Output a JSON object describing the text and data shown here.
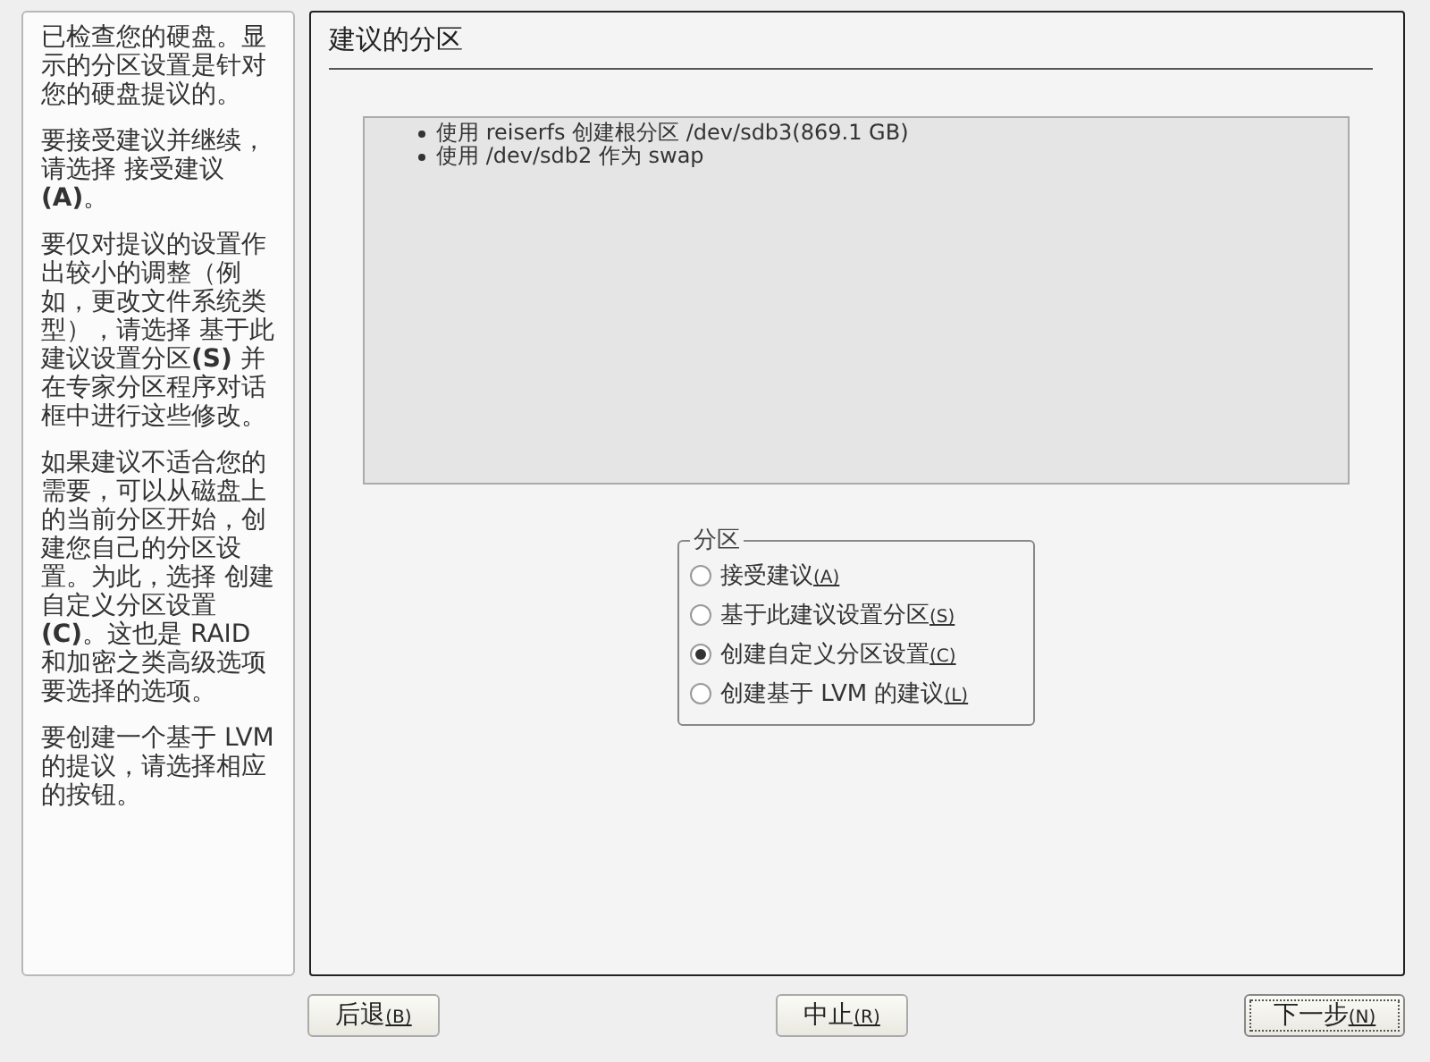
{
  "help": {
    "paragraphs": [
      "已检查您的硬盘。显示的分区设置是针对您的硬盘提议的。",
      "要接受建议并继续，请选择 接受建议**(A)**。",
      "要仅对提议的设置作出较小的调整（例如，更改文件系统类型），请选择 基于此建议设置分区**(S)** 并在专家分区程序对话框中进行这些修改。",
      "如果建议不适合您的需要，可以从磁盘上的当前分区开始，创建您自己的分区设置。为此，选择 创建自定义分区设置**(C)**。这也是 RAID 和加密之类高级选项要选择的选项。",
      "要创建一个基于 LVM 的提议，请选择相应的按钮。"
    ]
  },
  "title": "建议的分区",
  "summary": [
    "使用 reiserfs 创建根分区 /dev/sdb3(869.1 GB)",
    "使用 /dev/sdb2 作为 swap"
  ],
  "partition_group": {
    "legend": "分区",
    "options": [
      {
        "label": "接受建议",
        "accel": "(A)",
        "selected": false
      },
      {
        "label": "基于此建议设置分区",
        "accel": "(S)",
        "selected": false
      },
      {
        "label": "创建自定义分区设置",
        "accel": "(C)",
        "selected": true
      },
      {
        "label": "创建基于 LVM 的建议",
        "accel": "(L)",
        "selected": false
      }
    ]
  },
  "buttons": [
    {
      "label": "后退",
      "accel": "(B)",
      "default": false
    },
    {
      "label": "中止",
      "accel": "(R)",
      "default": false
    },
    {
      "label": "下一步",
      "accel": "(N)",
      "default": true
    }
  ]
}
